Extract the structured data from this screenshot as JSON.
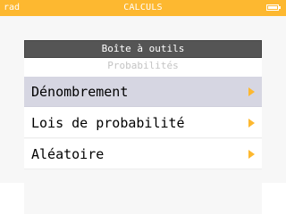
{
  "status_bar": {
    "angle_mode": "rad",
    "app_title": "CALCULS",
    "accent_color": "#fdb830"
  },
  "toolbox": {
    "title": "Boîte à outils",
    "section": "Probabilités",
    "items": [
      {
        "label": "Dénombrement",
        "arrow_icon": "submenu-arrow-icon",
        "selected": true
      },
      {
        "label": "Lois de probabilité",
        "arrow_icon": "submenu-arrow-icon",
        "selected": false
      },
      {
        "label": "Aléatoire",
        "arrow_icon": "submenu-arrow-icon",
        "selected": false
      }
    ]
  }
}
